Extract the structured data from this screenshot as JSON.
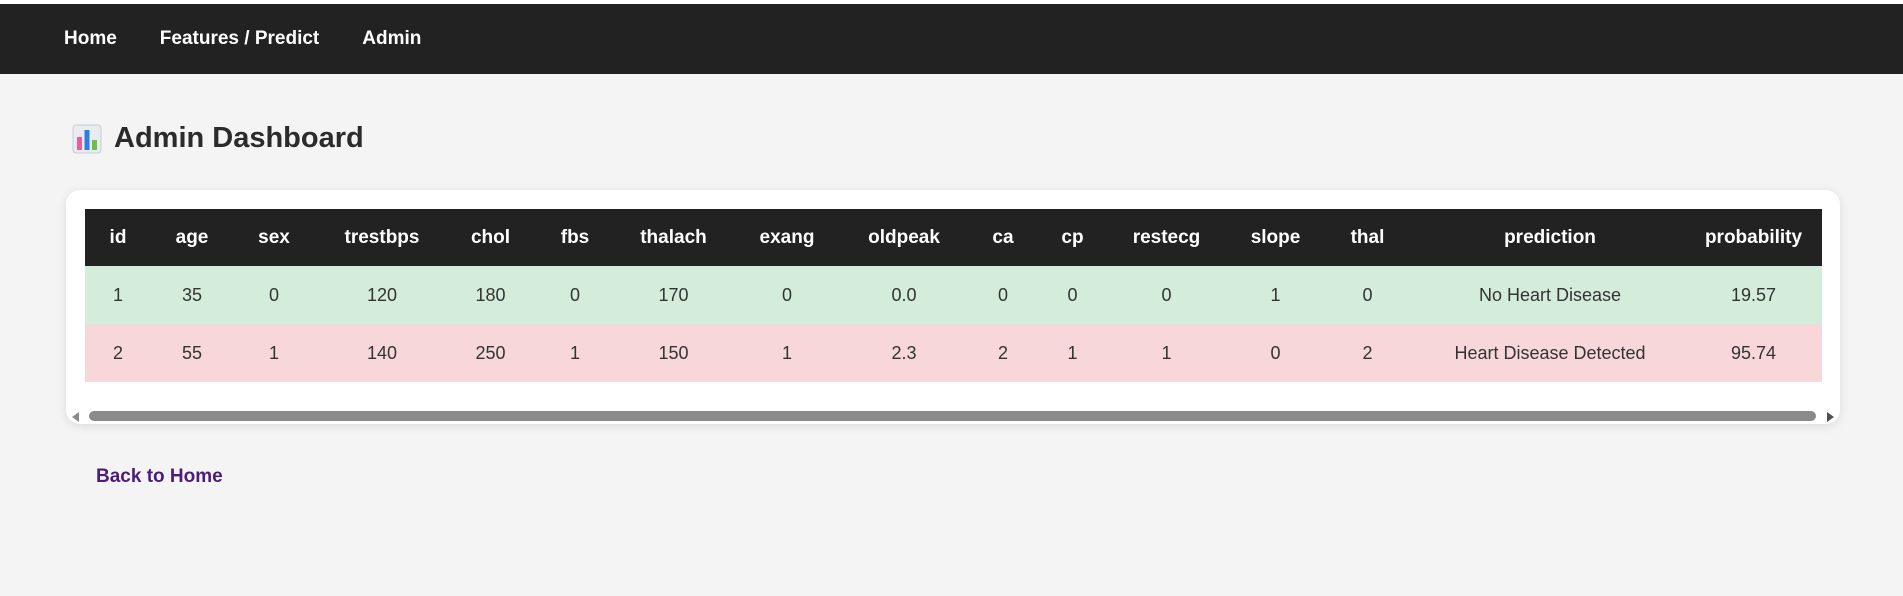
{
  "nav": {
    "items": [
      {
        "label": "Home"
      },
      {
        "label": "Features / Predict"
      },
      {
        "label": "Admin"
      }
    ]
  },
  "header": {
    "icon": "bar-chart-icon",
    "title": "Admin Dashboard"
  },
  "table": {
    "columns": [
      "id",
      "age",
      "sex",
      "trestbps",
      "chol",
      "fbs",
      "thalach",
      "exang",
      "oldpeak",
      "ca",
      "cp",
      "restecg",
      "slope",
      "thal",
      "prediction",
      "probability"
    ],
    "rows": [
      {
        "status": "negative",
        "cells": [
          "1",
          "35",
          "0",
          "120",
          "180",
          "0",
          "170",
          "0",
          "0.0",
          "0",
          "0",
          "0",
          "1",
          "0",
          "No Heart Disease",
          "19.57"
        ]
      },
      {
        "status": "positive",
        "cells": [
          "2",
          "55",
          "1",
          "140",
          "250",
          "1",
          "150",
          "1",
          "2.3",
          "2",
          "1",
          "1",
          "0",
          "2",
          "Heart Disease Detected",
          "95.74"
        ]
      }
    ]
  },
  "footer": {
    "back_label": "Back to Home"
  },
  "colors": {
    "navbar": "#222222",
    "page_background": "#f4f4f4",
    "row_negative": "#d4edda",
    "row_positive": "#f8d7da",
    "link": "#4b1c7a"
  }
}
